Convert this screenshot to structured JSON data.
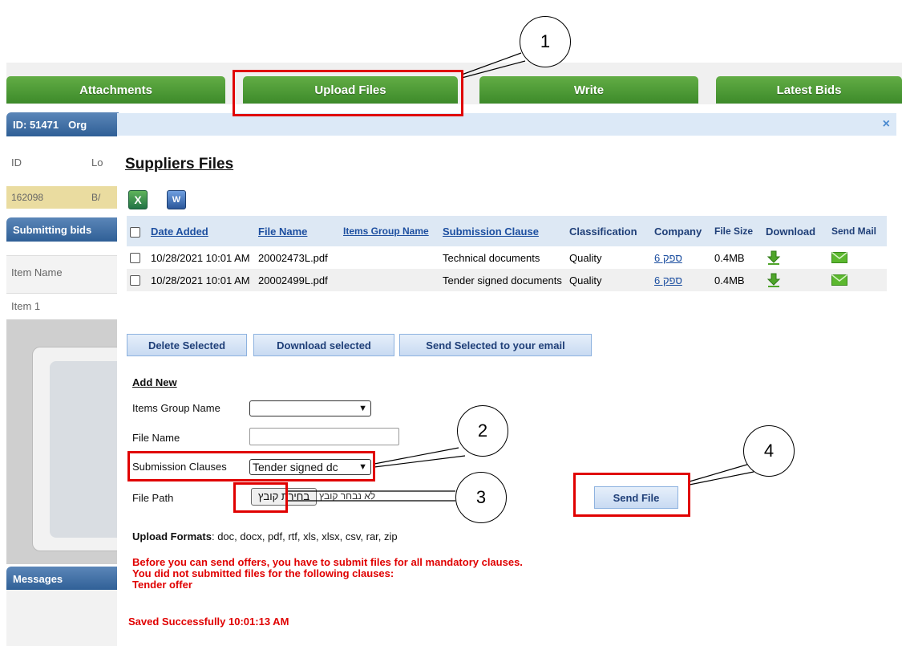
{
  "tabs": [
    {
      "label": "Attachments"
    },
    {
      "label": "Upload Files"
    },
    {
      "label": "Write"
    },
    {
      "label": "Latest Bids"
    }
  ],
  "background": {
    "id_bar": "ID: 51471",
    "id_bar_suffix": "Org",
    "col_id": "ID",
    "col_lo": "Lo",
    "row_id": "162098",
    "row_b": "B/",
    "submitting_bar": "Submitting bids",
    "item_name": "Item Name",
    "item_1": "Item 1",
    "messages_bar": "Messages"
  },
  "modal": {
    "close": "×",
    "title": "Suppliers Files",
    "excel_icon_label": "X",
    "word_icon_label": "W",
    "columns": {
      "date_added": "Date Added",
      "file_name": "File Name",
      "items_group_name": "Items Group Name",
      "submission_clause": "Submission Clause",
      "classification": "Classification",
      "company": "Company",
      "file_size": "File Size",
      "download": "Download",
      "send_mail": "Send Mail"
    },
    "rows": [
      {
        "date": "10/28/2021 10:01 AM",
        "file_name": "20002473L.pdf",
        "items_group": "",
        "clause": "Technical documents",
        "classification": "Quality",
        "company": "ספק 6",
        "size": "0.4MB"
      },
      {
        "date": "10/28/2021 10:01 AM",
        "file_name": "20002499L.pdf",
        "items_group": "",
        "clause": "Tender signed documents",
        "classification": "Quality",
        "company": "ספק 6",
        "size": "0.4MB"
      }
    ],
    "buttons": {
      "delete_selected": "Delete Selected",
      "download_selected": "Download selected",
      "send_selected": "Send Selected to your email",
      "send_file": "Send File"
    },
    "add_new": {
      "heading": "Add New",
      "items_group_label": "Items Group Name",
      "items_group_value": "",
      "file_name_label": "File Name",
      "file_name_value": "",
      "submission_label": "Submission Clauses",
      "submission_value": "Tender signed dc",
      "file_path_label": "File Path",
      "file_button": "בחירת קובץ",
      "file_note": "לא נבחר קובץ"
    },
    "upload_formats_label": "Upload Formats",
    "upload_formats": ": doc, docx, pdf, rtf, xls, xlsx, csv, rar, zip",
    "warnings": [
      "Before you can send offers, you have to submit files for all mandatory clauses.",
      "You did not submitted files for the following clauses:",
      "Tender offer"
    ],
    "saved": "Saved Successfully 10:01:13 AM"
  },
  "annotations": [
    "1",
    "2",
    "3",
    "4"
  ],
  "colors": {
    "tab_green": "#4f9c37",
    "header_blue": "#dde8f4",
    "link_blue": "#1d4fa0",
    "annotation_red": "#e00000",
    "warning_red": "#e00000"
  }
}
